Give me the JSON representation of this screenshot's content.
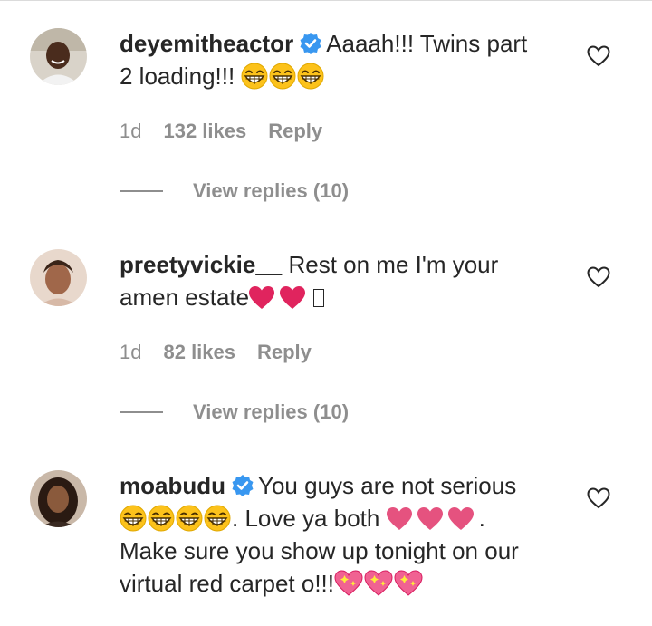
{
  "comments": [
    {
      "username": "deyemitheactor",
      "verified": true,
      "text_line1": "Aaaah!!! Twins part",
      "text_line2": "2 loading!!!",
      "emoji_line2": "😁😁😁",
      "time": "1d",
      "likes": "132 likes",
      "reply_label": "Reply",
      "view_replies": "View replies (10)",
      "avatar_icon": "profile-photo"
    },
    {
      "username": "preetyvickie__",
      "verified": false,
      "text_line1": "Rest on me I'm your",
      "text_line2": "amen estate",
      "emoji_line2": "❤️❤️",
      "time": "1d",
      "likes": "82 likes",
      "reply_label": "Reply",
      "view_replies": "View replies (10)",
      "avatar_icon": "profile-photo"
    },
    {
      "username": "moabudu",
      "verified": true,
      "text_line1": "You guys are not serious",
      "text_line2_emoji": "😁😁😁😁",
      "text_line2": ". Love ya both",
      "text_line2_hearts": "💗💗💗",
      "text_line2_end": ".",
      "text_line3": "Make sure you show up tonight on our",
      "text_line4": "virtual red carpet o!!!",
      "emoji_line4": "💖💖💖",
      "avatar_icon": "profile-photo"
    }
  ],
  "colors": {
    "text": "#262626",
    "muted": "#8e8e8e",
    "verified_blue": "#3897f0",
    "heart_red": "#e0245e",
    "heart_pink": "#e5527f"
  },
  "icons": {
    "like": "heart-outline-icon",
    "verified": "verified-badge-icon"
  }
}
